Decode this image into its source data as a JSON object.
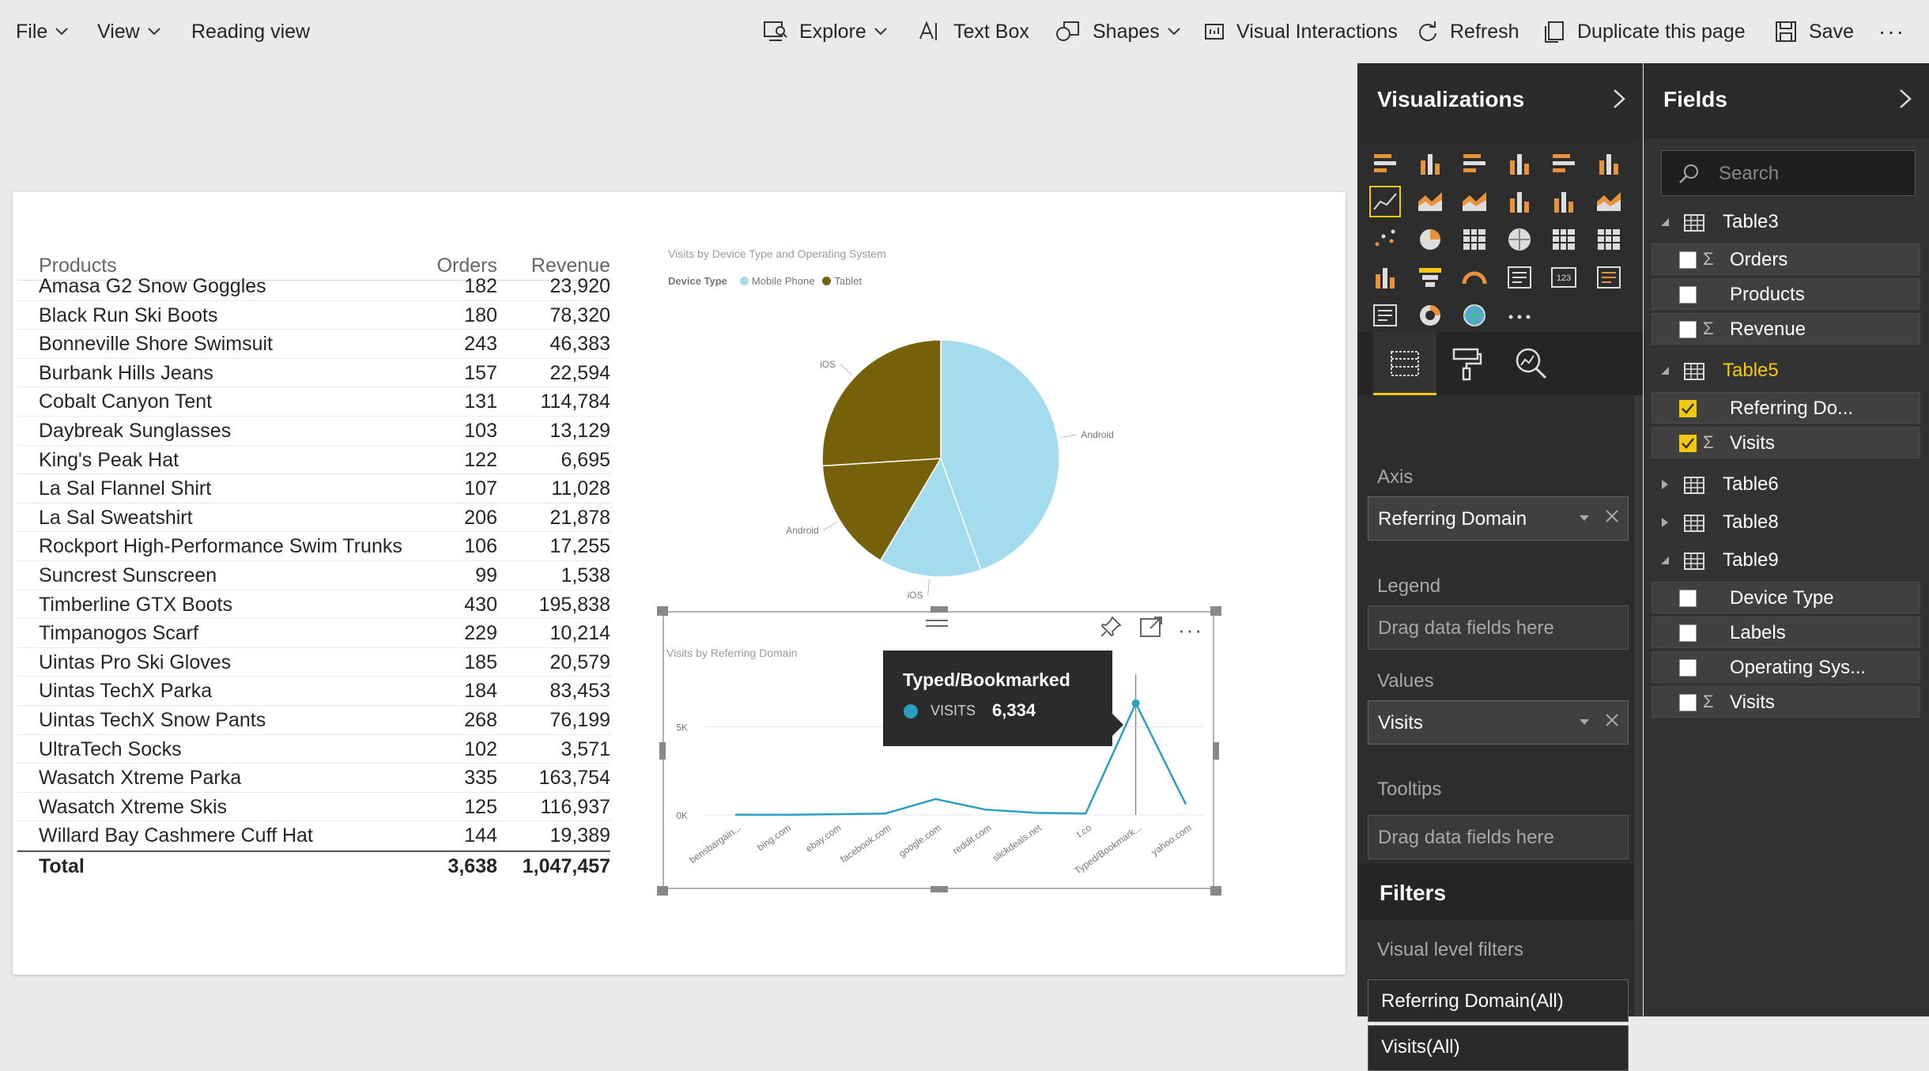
{
  "menus": {
    "file": "File",
    "view": "View",
    "reading_view": "Reading view"
  },
  "toolbar": {
    "explore": "Explore",
    "text_box": "Text Box",
    "shapes": "Shapes",
    "visual_interactions": "Visual Interactions",
    "refresh": "Refresh",
    "duplicate": "Duplicate this page",
    "save": "Save",
    "more": "···"
  },
  "table": {
    "headers": {
      "products": "Products",
      "orders": "Orders",
      "revenue": "Revenue"
    },
    "rows": [
      {
        "name": "Amasa G2 Snow Goggles",
        "orders": "182",
        "revenue": "23,920"
      },
      {
        "name": "Black Run Ski Boots",
        "orders": "180",
        "revenue": "78,320"
      },
      {
        "name": "Bonneville Shore Swimsuit",
        "orders": "243",
        "revenue": "46,383"
      },
      {
        "name": "Burbank Hills Jeans",
        "orders": "157",
        "revenue": "22,594"
      },
      {
        "name": "Cobalt Canyon Tent",
        "orders": "131",
        "revenue": "114,784"
      },
      {
        "name": "Daybreak Sunglasses",
        "orders": "103",
        "revenue": "13,129"
      },
      {
        "name": "King's Peak Hat",
        "orders": "122",
        "revenue": "6,695"
      },
      {
        "name": "La Sal Flannel Shirt",
        "orders": "107",
        "revenue": "11,028"
      },
      {
        "name": "La Sal Sweatshirt",
        "orders": "206",
        "revenue": "21,878"
      },
      {
        "name": "Rockport High-Performance Swim Trunks",
        "orders": "106",
        "revenue": "17,255"
      },
      {
        "name": "Suncrest Sunscreen",
        "orders": "99",
        "revenue": "1,538"
      },
      {
        "name": "Timberline GTX Boots",
        "orders": "430",
        "revenue": "195,838"
      },
      {
        "name": "Timpanogos Scarf",
        "orders": "229",
        "revenue": "10,214"
      },
      {
        "name": "Uintas Pro Ski Gloves",
        "orders": "185",
        "revenue": "20,579"
      },
      {
        "name": "Uintas TechX Parka",
        "orders": "184",
        "revenue": "83,453"
      },
      {
        "name": "Uintas TechX Snow Pants",
        "orders": "268",
        "revenue": "76,199"
      },
      {
        "name": "UltraTech Socks",
        "orders": "102",
        "revenue": "3,571"
      },
      {
        "name": "Wasatch Xtreme Parka",
        "orders": "335",
        "revenue": "163,754"
      },
      {
        "name": "Wasatch Xtreme Skis",
        "orders": "125",
        "revenue": "116,937"
      },
      {
        "name": "Willard Bay Cashmere Cuff Hat",
        "orders": "144",
        "revenue": "19,389"
      }
    ],
    "total": {
      "label": "Total",
      "orders": "3,638",
      "revenue": "1,047,457"
    }
  },
  "pie_chart": {
    "title": "Visits by Device Type and Operating System",
    "legend_label": "Device Type",
    "legend": [
      {
        "name": "Mobile Phone",
        "color": "#a3dcef"
      },
      {
        "name": "Tablet",
        "color": "#766009"
      }
    ],
    "slices": [
      {
        "group": "Mobile Phone",
        "os": "Android",
        "fraction": 0.445,
        "color": "#a3dcef"
      },
      {
        "group": "Mobile Phone",
        "os": "iOS",
        "fraction": 0.14,
        "color": "#a3dcef"
      },
      {
        "group": "Tablet",
        "os": "Android",
        "fraction": 0.155,
        "color": "#766009"
      },
      {
        "group": "Tablet",
        "os": "iOS",
        "fraction": 0.26,
        "color": "#766009"
      }
    ]
  },
  "line_chart": {
    "title": "Visits by Referring Domain",
    "y_ticks": [
      "5K",
      "0K"
    ],
    "tooltip": {
      "title": "Typed/Bookmarked",
      "measure": "VISITS",
      "value": "6,334"
    }
  },
  "chart_data": {
    "type": "line",
    "title": "Visits by Referring Domain",
    "x": [
      "bensbargain...",
      "bing.com",
      "ebay.com",
      "facebook.com",
      "google.com",
      "reddit.com",
      "slickdeals.net",
      "t.co",
      "Typed/Bookmark...",
      "yahoo.com"
    ],
    "series": [
      {
        "name": "Visits",
        "values": [
          10,
          5,
          40,
          80,
          900,
          300,
          120,
          80,
          6334,
          600
        ]
      }
    ],
    "ylim": [
      0,
      7000
    ],
    "color": "#2b9fc1"
  },
  "visualizations": {
    "title": "Visualizations",
    "wells": {
      "axis_label": "Axis",
      "axis_value": "Referring Domain",
      "legend_label": "Legend",
      "legend_placeholder": "Drag data fields here",
      "values_label": "Values",
      "values_value": "Visits",
      "tooltips_label": "Tooltips",
      "tooltips_placeholder": "Drag data fields here"
    },
    "filters": {
      "title": "Filters",
      "visual_level_label": "Visual level filters",
      "items": [
        "Referring Domain(All)",
        "Visits(All)"
      ]
    }
  },
  "fields": {
    "title": "Fields",
    "search_placeholder": "Search",
    "tables": [
      {
        "name": "Table3",
        "expanded": true,
        "active": false,
        "fields": [
          {
            "name": "Orders",
            "sigma": true,
            "checked": false
          },
          {
            "name": "Products",
            "sigma": false,
            "checked": false
          },
          {
            "name": "Revenue",
            "sigma": true,
            "checked": false
          }
        ]
      },
      {
        "name": "Table5",
        "expanded": true,
        "active": true,
        "fields": [
          {
            "name": "Referring Do...",
            "sigma": false,
            "checked": true
          },
          {
            "name": "Visits",
            "sigma": true,
            "checked": true
          }
        ]
      },
      {
        "name": "Table6",
        "expanded": false,
        "active": false,
        "fields": []
      },
      {
        "name": "Table8",
        "expanded": false,
        "active": false,
        "fields": []
      },
      {
        "name": "Table9",
        "expanded": true,
        "active": false,
        "fields": [
          {
            "name": "Device Type",
            "sigma": false,
            "checked": false
          },
          {
            "name": "Labels",
            "sigma": false,
            "checked": false
          },
          {
            "name": "Operating Sys...",
            "sigma": false,
            "checked": false
          },
          {
            "name": "Visits",
            "sigma": true,
            "checked": false
          }
        ]
      }
    ]
  },
  "colors": {
    "accent": "#f2c811",
    "line": "#2b9fc1",
    "mobile": "#a3dcef",
    "tablet": "#766009"
  }
}
